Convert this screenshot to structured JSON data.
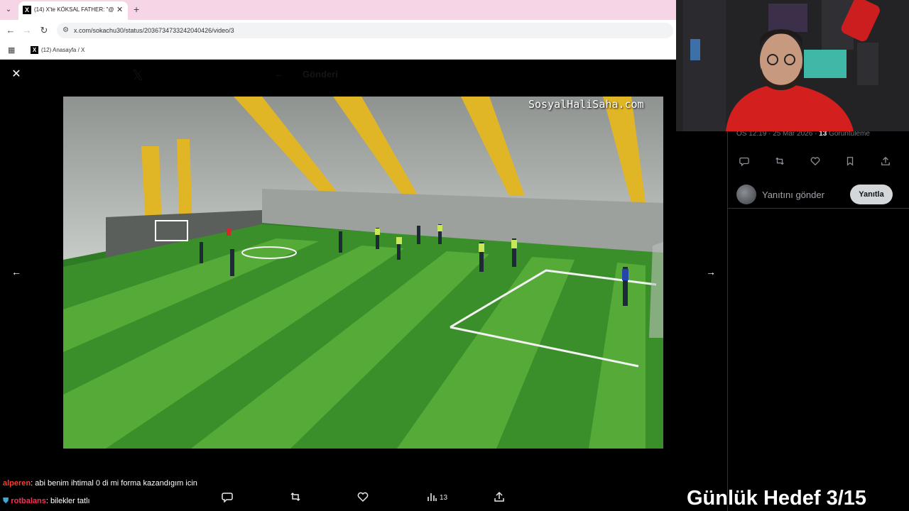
{
  "browser": {
    "tab_title": "(14) X'te KÖKSAL FATHER: \"@z",
    "tab_favicon": "X",
    "url": "x.com/sokachu30/status/2036734733242040426/video/3",
    "bookmark_label": "(12) Anasayfa / X",
    "bookmark_favicon": "X"
  },
  "viewer": {
    "header_ghost_title": "Gönderi",
    "watermark": "SosyalHaliSaha.com",
    "views_count": "13"
  },
  "right_panel": {
    "meta_time": "ÖS 12:19 · 25 Mar 2026 · ",
    "meta_views_number": "13",
    "meta_views_label": " Görüntüleme",
    "reply_placeholder": "Yanıtını gönder",
    "reply_button": "Yanıtla"
  },
  "overlay": {
    "chat": [
      {
        "user": "alperen",
        "message": ": abi benim ihtimal 0 di mi forma kazandıgım icin",
        "color": "#ff3b30"
      },
      {
        "user": "rotbalans",
        "message": ": bilekler tatlı",
        "color": "#ff2d55"
      }
    ],
    "goal_text": "Günlük Hedef 3/15"
  },
  "icons": {
    "close": "close-icon",
    "prev": "arrow-left-icon",
    "next": "arrow-right-icon",
    "reply": "reply-icon",
    "repost": "repost-icon",
    "like": "heart-icon",
    "views": "views-icon",
    "bookmark": "bookmark-icon",
    "share": "share-icon"
  }
}
